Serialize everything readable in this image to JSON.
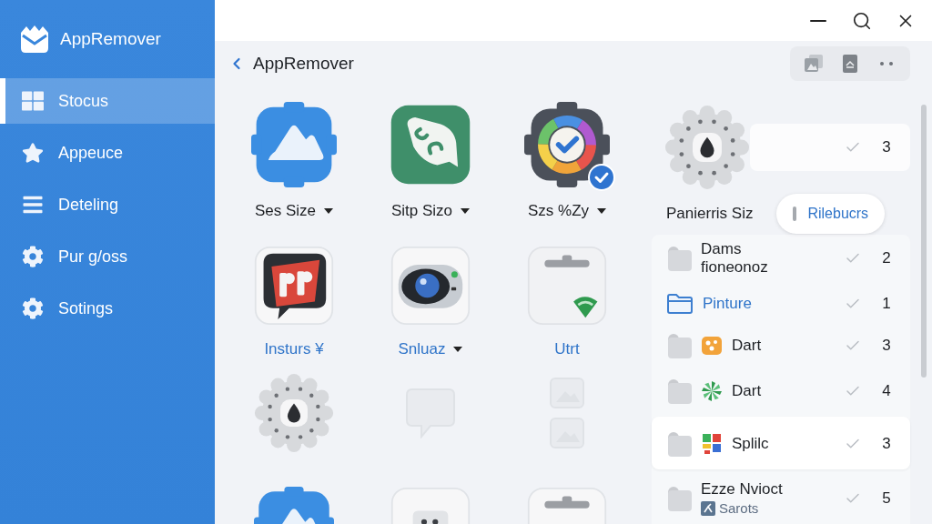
{
  "sidebar": {
    "title": "AppRemover",
    "items": [
      {
        "label": "Stocus",
        "selected": true
      },
      {
        "label": "Appeuce",
        "selected": false
      },
      {
        "label": "Deteling",
        "selected": false
      },
      {
        "label": "Pur g/oss",
        "selected": false
      },
      {
        "label": "Sotings",
        "selected": false
      }
    ]
  },
  "header": {
    "title": "AppRemover"
  },
  "apps": [
    {
      "label": "Ses Size",
      "dropdown": true,
      "link": false,
      "selected": false,
      "faded": false
    },
    {
      "label": "Sitp Sizo",
      "dropdown": true,
      "link": false,
      "selected": false,
      "faded": false
    },
    {
      "label": "Szs %Zy",
      "dropdown": true,
      "link": false,
      "selected": true,
      "faded": false
    },
    {
      "label": "Insturs ¥",
      "dropdown": false,
      "link": true,
      "selected": false,
      "faded": false
    },
    {
      "label": "Snluaz",
      "dropdown": true,
      "link": true,
      "selected": false,
      "faded": false
    },
    {
      "label": "Utrt",
      "dropdown": false,
      "link": true,
      "selected": false,
      "faded": false
    },
    {
      "selected": false,
      "faded": false
    },
    {
      "selected": false,
      "faded": true
    },
    {
      "selected": false,
      "faded": true
    },
    {
      "faded": false
    },
    {
      "faded": false
    },
    {
      "faded": false
    }
  ],
  "details": {
    "summary_count": "3",
    "name": "Panierris Siz",
    "action": "Rilebucrs",
    "rows": [
      {
        "name": "Dams fioneonoz",
        "count": "2",
        "link": false,
        "selected": false
      },
      {
        "name": "Pinture",
        "count": "1",
        "link": true,
        "selected": false
      },
      {
        "name": "Dart",
        "count": "3",
        "link": false,
        "selected": false
      },
      {
        "name": "Dart",
        "count": "4",
        "link": false,
        "selected": false
      },
      {
        "name": "Splilc",
        "count": "3",
        "link": false,
        "selected": true
      },
      {
        "name": "Ezze Nvioct",
        "count": "5",
        "link": false,
        "selected": false,
        "subtitle": "Sarots"
      }
    ]
  }
}
